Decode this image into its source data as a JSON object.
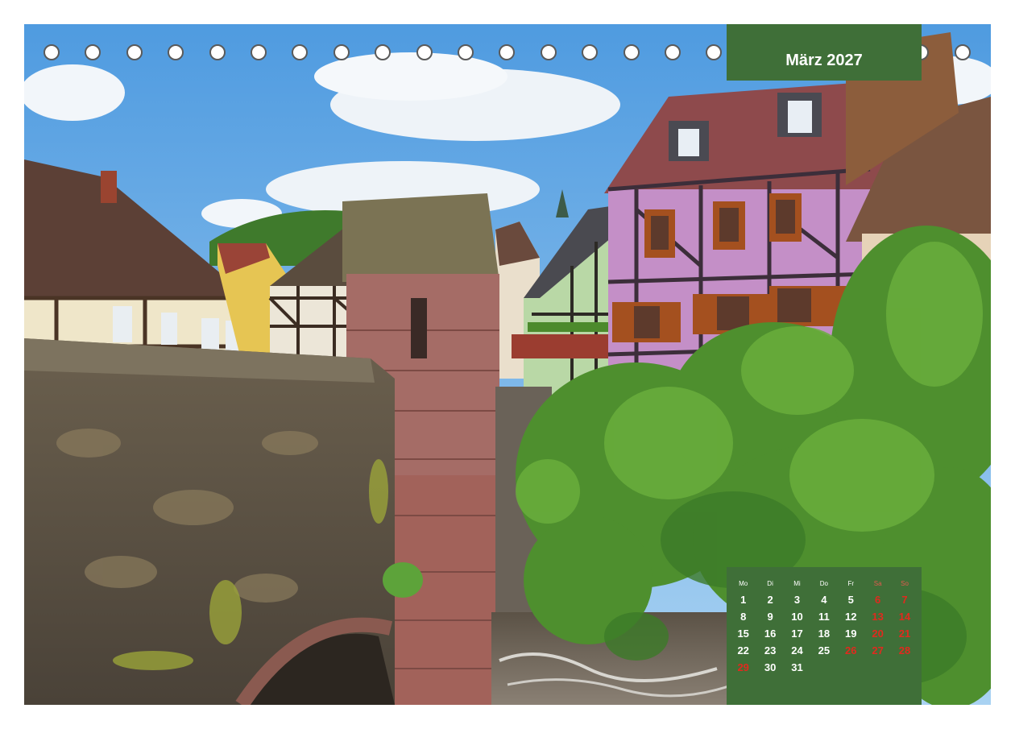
{
  "calendar": {
    "title": "März 2027",
    "weekdays": [
      "Mo",
      "Di",
      "Mi",
      "Do",
      "Fr",
      "Sa",
      "So"
    ],
    "weeks": [
      [
        "1",
        "2",
        "3",
        "4",
        "5",
        "6",
        "7"
      ],
      [
        "8",
        "9",
        "10",
        "11",
        "12",
        "13",
        "14"
      ],
      [
        "15",
        "16",
        "17",
        "18",
        "19",
        "20",
        "21"
      ],
      [
        "22",
        "23",
        "24",
        "25",
        "26",
        "27",
        "28"
      ],
      [
        "29",
        "30",
        "31",
        "",
        "",
        "",
        ""
      ]
    ],
    "weekend_color": "#e02a1e",
    "box_color": "#3f6f38"
  },
  "binding": {
    "ring_count": 23
  },
  "photo": {
    "subject": "half-timbered-houses-and-stone-bridge"
  }
}
